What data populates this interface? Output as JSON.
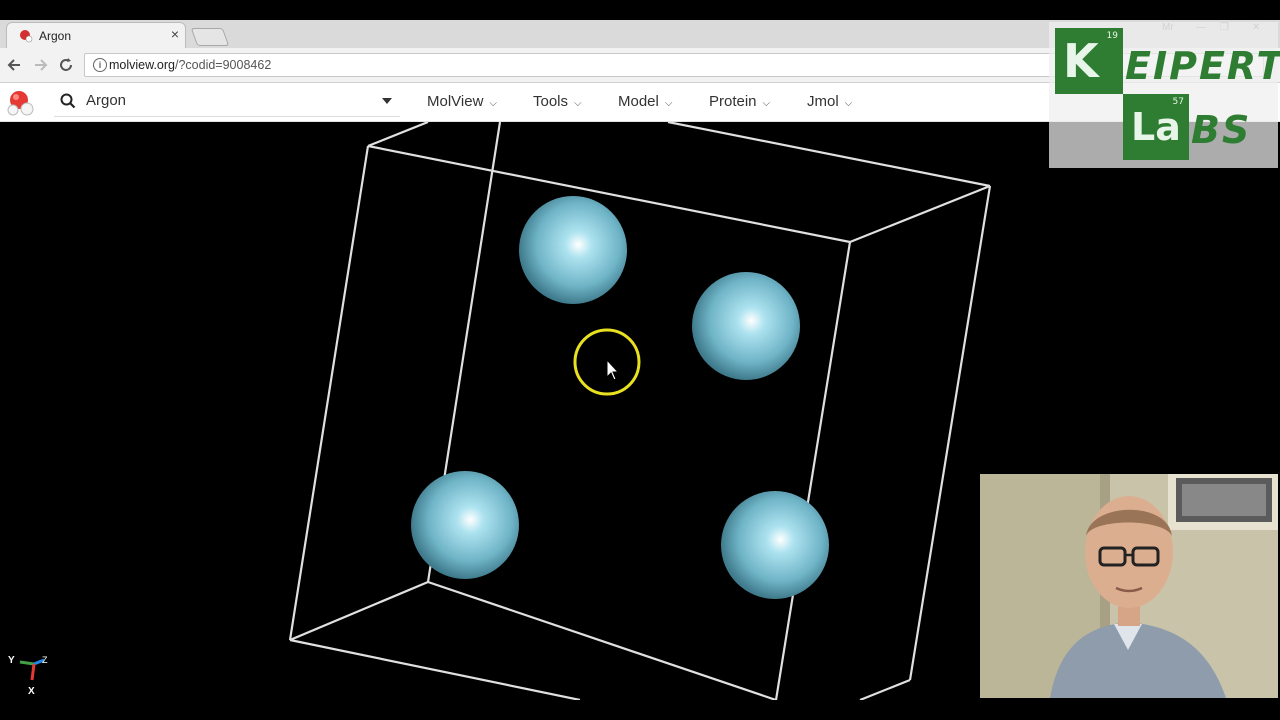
{
  "browser": {
    "tab": {
      "title": "Argon",
      "close_glyph": "×"
    },
    "url": {
      "host": "molview.org",
      "path": "/?codid=9008462"
    },
    "window_controls": [
      "Mr",
      "—",
      "❐",
      "✕"
    ]
  },
  "app": {
    "search": {
      "value": "Argon"
    },
    "menu": [
      {
        "label": "MolView"
      },
      {
        "label": "Tools"
      },
      {
        "label": "Model"
      },
      {
        "label": "Protein"
      },
      {
        "label": "Jmol"
      }
    ],
    "menu_chevron": "⌵"
  },
  "viewer": {
    "atom_color": "#7fc0d2",
    "cell_edge_color": "#e0e0e0",
    "background": "#000000",
    "axes": {
      "x": "X",
      "y": "Y",
      "z": "Z"
    }
  },
  "watermark": {
    "k_number": "19",
    "k_symbol": "K",
    "k_rest": "EIPERT",
    "la_number": "57",
    "la_symbol": "La",
    "la_rest": "BS"
  }
}
